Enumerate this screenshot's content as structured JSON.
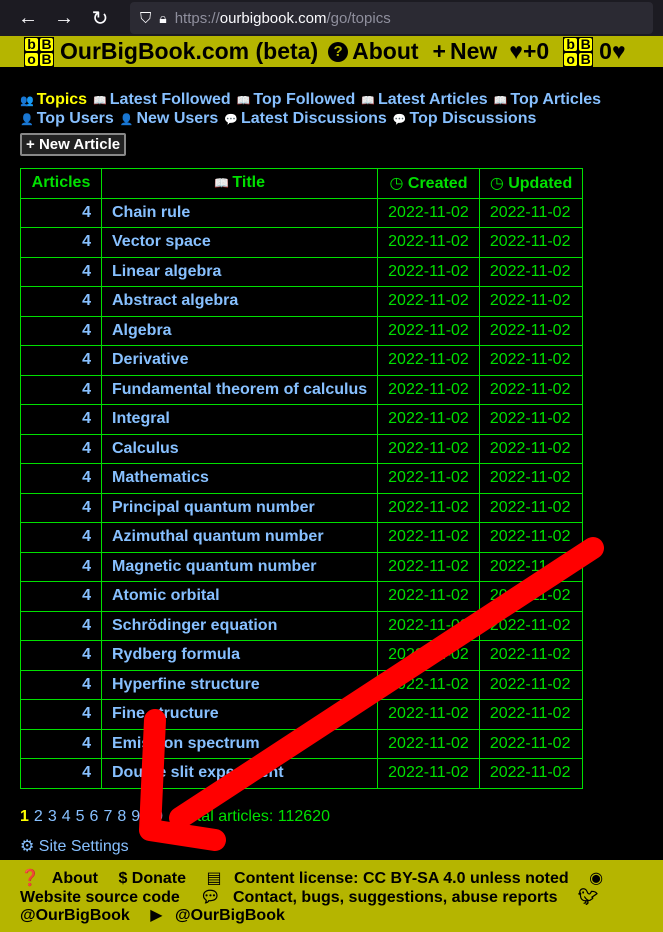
{
  "browser": {
    "url_prefix": "https://",
    "url_domain": "ourbigbook.com",
    "url_path": "/go/topics"
  },
  "topnav": {
    "logo": "OBB",
    "site_title": "OurBigBook.com (beta)",
    "about": "About",
    "new": "New",
    "score": "♥+0",
    "user_score": "0♥"
  },
  "tabs": [
    {
      "icon": "👥",
      "label": "Topics",
      "active": true
    },
    {
      "icon": "📖",
      "label": "Latest Followed"
    },
    {
      "icon": "📖",
      "label": "Top Followed"
    },
    {
      "icon": "📖",
      "label": "Latest Articles"
    },
    {
      "icon": "📖",
      "label": "Top Articles"
    },
    {
      "icon": "👤",
      "label": "Top Users"
    },
    {
      "icon": "👤",
      "label": "New Users"
    },
    {
      "icon": "💬",
      "label": "Latest Discussions"
    },
    {
      "icon": "💬",
      "label": "Top Discussions"
    }
  ],
  "new_article_label": "New Article",
  "table": {
    "headers": {
      "articles": "Articles",
      "title": "Title",
      "created": "Created",
      "updated": "Updated"
    },
    "rows": [
      {
        "articles": "4",
        "title": "Chain rule",
        "created": "2022-11-02",
        "updated": "2022-11-02"
      },
      {
        "articles": "4",
        "title": "Vector space",
        "created": "2022-11-02",
        "updated": "2022-11-02"
      },
      {
        "articles": "4",
        "title": "Linear algebra",
        "created": "2022-11-02",
        "updated": "2022-11-02"
      },
      {
        "articles": "4",
        "title": "Abstract algebra",
        "created": "2022-11-02",
        "updated": "2022-11-02"
      },
      {
        "articles": "4",
        "title": "Algebra",
        "created": "2022-11-02",
        "updated": "2022-11-02"
      },
      {
        "articles": "4",
        "title": "Derivative",
        "created": "2022-11-02",
        "updated": "2022-11-02"
      },
      {
        "articles": "4",
        "title": "Fundamental theorem of calculus",
        "created": "2022-11-02",
        "updated": "2022-11-02"
      },
      {
        "articles": "4",
        "title": "Integral",
        "created": "2022-11-02",
        "updated": "2022-11-02"
      },
      {
        "articles": "4",
        "title": "Calculus",
        "created": "2022-11-02",
        "updated": "2022-11-02"
      },
      {
        "articles": "4",
        "title": "Mathematics",
        "created": "2022-11-02",
        "updated": "2022-11-02"
      },
      {
        "articles": "4",
        "title": "Principal quantum number",
        "created": "2022-11-02",
        "updated": "2022-11-02"
      },
      {
        "articles": "4",
        "title": "Azimuthal quantum number",
        "created": "2022-11-02",
        "updated": "2022-11-02"
      },
      {
        "articles": "4",
        "title": "Magnetic quantum number",
        "created": "2022-11-02",
        "updated": "2022-11-02"
      },
      {
        "articles": "4",
        "title": "Atomic orbital",
        "created": "2022-11-02",
        "updated": "2022-11-02"
      },
      {
        "articles": "4",
        "title": "Schrödinger equation",
        "created": "2022-11-02",
        "updated": "2022-11-02"
      },
      {
        "articles": "4",
        "title": "Rydberg formula",
        "created": "2022-11-02",
        "updated": "2022-11-02"
      },
      {
        "articles": "4",
        "title": "Hyperfine structure",
        "created": "2022-11-02",
        "updated": "2022-11-02"
      },
      {
        "articles": "4",
        "title": "Fine structure",
        "created": "2022-11-02",
        "updated": "2022-11-02"
      },
      {
        "articles": "4",
        "title": "Emission spectrum",
        "created": "2022-11-02",
        "updated": "2022-11-02"
      },
      {
        "articles": "4",
        "title": "Double slit experiment",
        "created": "2022-11-02",
        "updated": "2022-11-02"
      }
    ]
  },
  "pager": {
    "pages": [
      "1",
      "2",
      "3",
      "4",
      "5",
      "6",
      "7",
      "8",
      "9",
      "10"
    ],
    "current": "1",
    "total": "Total articles: 112620"
  },
  "site_settings": "Site Settings",
  "footer": {
    "about": "About",
    "donate": "Donate",
    "license": "Content license: CC BY-SA 4.0 unless noted",
    "source": "Website source code",
    "contact": "Contact, bugs, suggestions, abuse reports",
    "twitter": "@OurBigBook",
    "youtube": "@OurBigBook"
  },
  "colors": {
    "accent": "#b5b500",
    "link": "#87c0ff",
    "table_border": "#00e000",
    "active_tab": "#ffff00",
    "annotation_arrow": "#ff0000"
  }
}
